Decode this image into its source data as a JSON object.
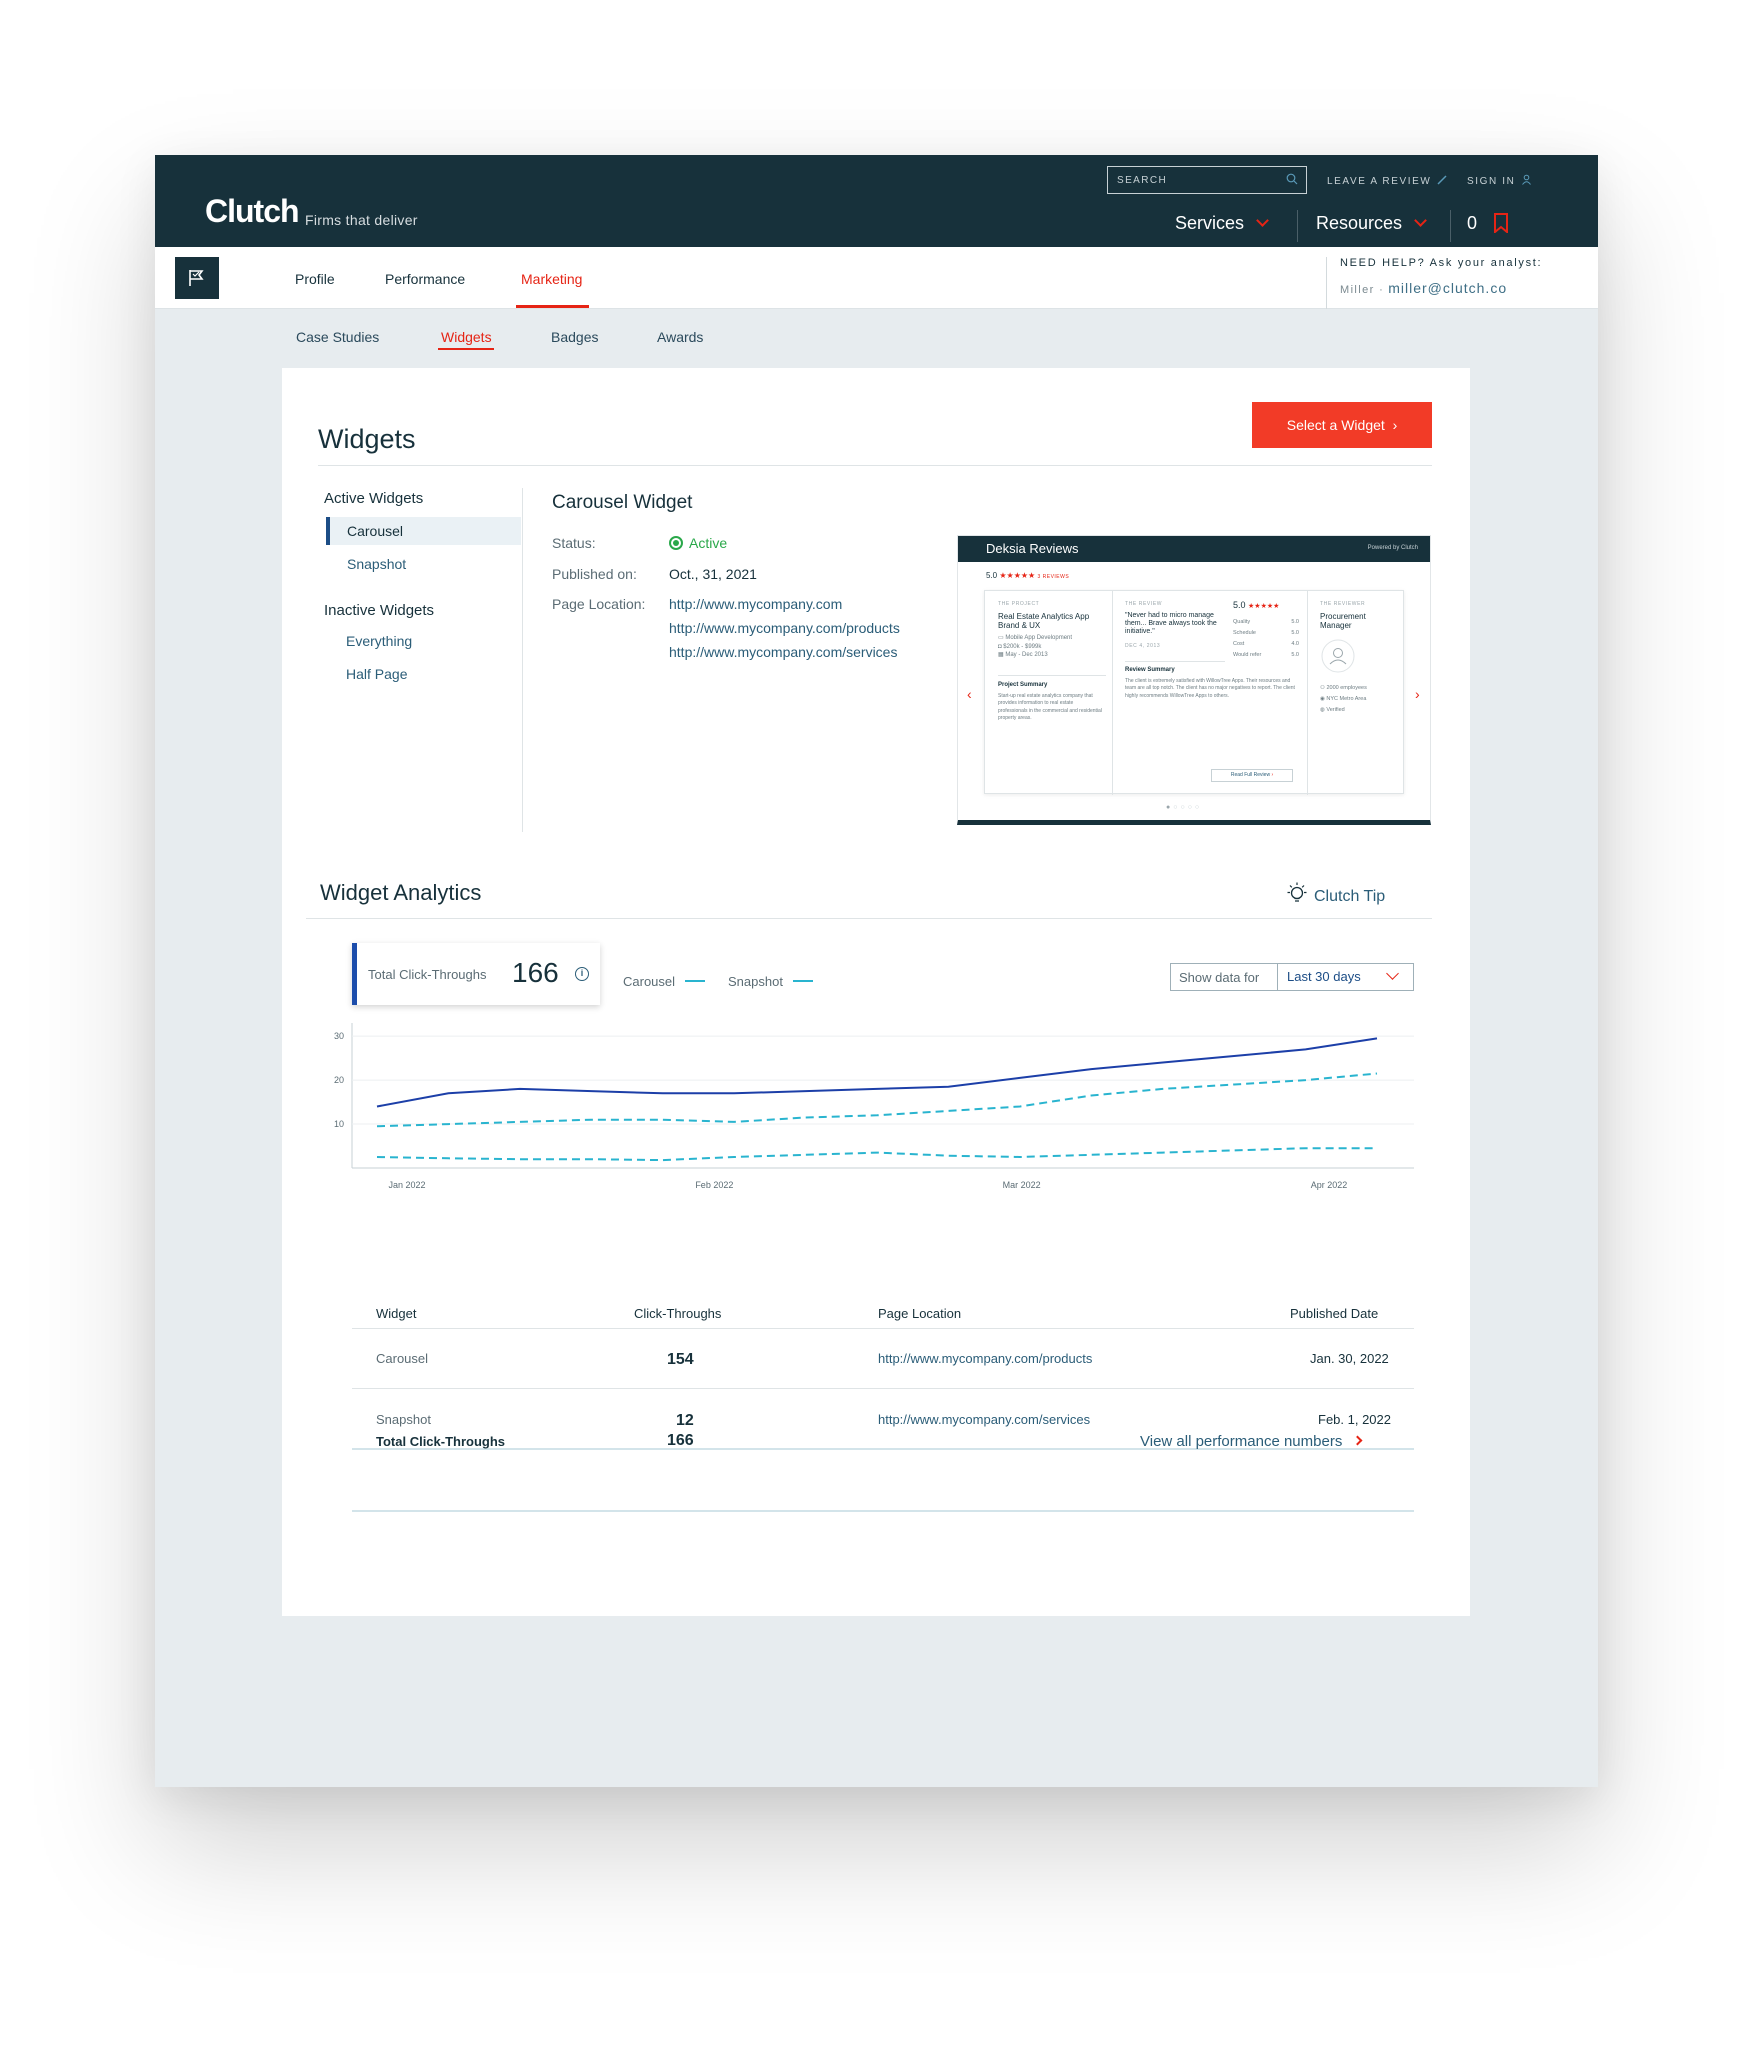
{
  "header": {
    "logo": "Clutch",
    "tagline": "Firms that deliver",
    "search_placeholder": "SEARCH",
    "leave_review": "LEAVE A REVIEW",
    "sign_in": "SIGN IN",
    "services": "Services",
    "resources": "Resources",
    "saved_count": "0"
  },
  "subnav": {
    "tabs": [
      "Profile",
      "Performance",
      "Marketing"
    ],
    "active_tab": "Marketing",
    "help_label": "NEED HELP?  Ask your analyst:",
    "analyst_name": "Miller ·",
    "analyst_email": "miller@clutch.co"
  },
  "marketing_tabs": [
    "Case Studies",
    "Widgets",
    "Badges",
    "Awards"
  ],
  "widgets": {
    "title": "Widgets",
    "select_button": "Select a Widget",
    "active_heading": "Active Widgets",
    "active_items": [
      "Carousel",
      "Snapshot"
    ],
    "selected": "Carousel",
    "inactive_heading": "Inactive Widgets",
    "inactive_items": [
      "Everything",
      "Half Page"
    ],
    "detail": {
      "title": "Carousel Widget",
      "status_label": "Status:",
      "status_value": "Active",
      "published_label": "Published on:",
      "published_value": "Oct., 31, 2021",
      "location_label": "Page Location:",
      "locations": [
        "http://www.mycompany.com",
        "http://www.mycompany.com/products",
        "http://www.mycompany.com/services"
      ]
    },
    "preview": {
      "title": "Deksia Reviews",
      "powered": "Powered by Clutch",
      "rating": "5.0",
      "stars": "★★★★★",
      "reviews": "3 REVIEWS",
      "project_label": "THE PROJECT",
      "project_title": "Real Estate Analytics App Brand & UX",
      "project_meta": [
        "Mobile App Development",
        "$200k - $999k",
        "May - Dec 2013"
      ],
      "project_summary_h": "Project Summary",
      "project_summary": "Start-up real estate analytics company that provides information to real estate professionals in the commercial and residential property areas.",
      "review_label": "THE REVIEW",
      "quote": "\"Never had to micro manage them... Brave always took the initiative.\"",
      "review_date": "DEC 4, 2013",
      "score": "5.0",
      "score_rows": [
        [
          "Quality",
          "5.0"
        ],
        [
          "Schedule",
          "5.0"
        ],
        [
          "Cost",
          "4.0"
        ],
        [
          "Would refer",
          "5.0"
        ]
      ],
      "review_summary_h": "Review Summary",
      "review_summary": "The client is extremely satisfied with WillowTree Apps. Their resources and team are all top notch. The client has no major negatives to report. The client highly recommends WillowTree Apps to others.",
      "read_full": "Read Full Review",
      "reviewer_label": "THE REVIEWER",
      "reviewer_title": "Procurement Manager",
      "reviewer_meta": [
        "2000 employees",
        "NYC Metro Area",
        "Verified"
      ]
    }
  },
  "analytics": {
    "title": "Widget Analytics",
    "tip": "Clutch Tip",
    "kpi_label": "Total Click-Throughs",
    "kpi_value": "166",
    "legend": [
      "Carousel",
      "Snapshot"
    ],
    "show_label": "Show data for",
    "range": "Last 30 days",
    "colors": {
      "carousel": "#1c3fa8",
      "snapshot": "#29b4cf"
    }
  },
  "chart_data": {
    "type": "line",
    "title": "",
    "xlabel": "",
    "ylabel": "",
    "x_ticks": [
      "Jan 2022",
      "Feb 2022",
      "Mar 2022",
      "Apr 2022"
    ],
    "y_ticks": [
      10,
      20,
      30
    ],
    "ylim": [
      0,
      33
    ],
    "grid": true,
    "series": [
      {
        "style": "solid",
        "color": "#1c3fa8",
        "values": [
          14,
          17,
          18,
          17.5,
          17,
          17,
          17.5,
          18,
          18.5,
          20.5,
          22.5,
          24,
          25.5,
          27,
          29.5
        ]
      },
      {
        "style": "dashed",
        "color": "#29b4cf",
        "values": [
          9.5,
          10,
          10.5,
          11,
          11,
          10.5,
          11.5,
          12,
          13,
          14,
          16.5,
          18,
          19,
          20,
          21.5
        ]
      },
      {
        "style": "dashed",
        "color": "#29b4cf",
        "values": [
          2.5,
          2.2,
          2,
          2,
          1.8,
          2.5,
          3,
          3.5,
          2.8,
          2.5,
          3,
          3.5,
          4,
          4.5,
          4.5
        ]
      }
    ]
  },
  "table": {
    "headers": [
      "Widget",
      "Click-Throughs",
      "Page Location",
      "Published Date"
    ],
    "rows": [
      {
        "widget": "Carousel",
        "clicks": "154",
        "location": "http://www.mycompany.com/products",
        "date": "Jan. 30, 2022"
      },
      {
        "widget": "Snapshot",
        "clicks": "12",
        "location": "http://www.mycompany.com/services",
        "date": "Feb. 1, 2022"
      }
    ],
    "total_label": "Total Click-Throughs",
    "total_value": "166",
    "view_all": "View all performance numbers"
  }
}
